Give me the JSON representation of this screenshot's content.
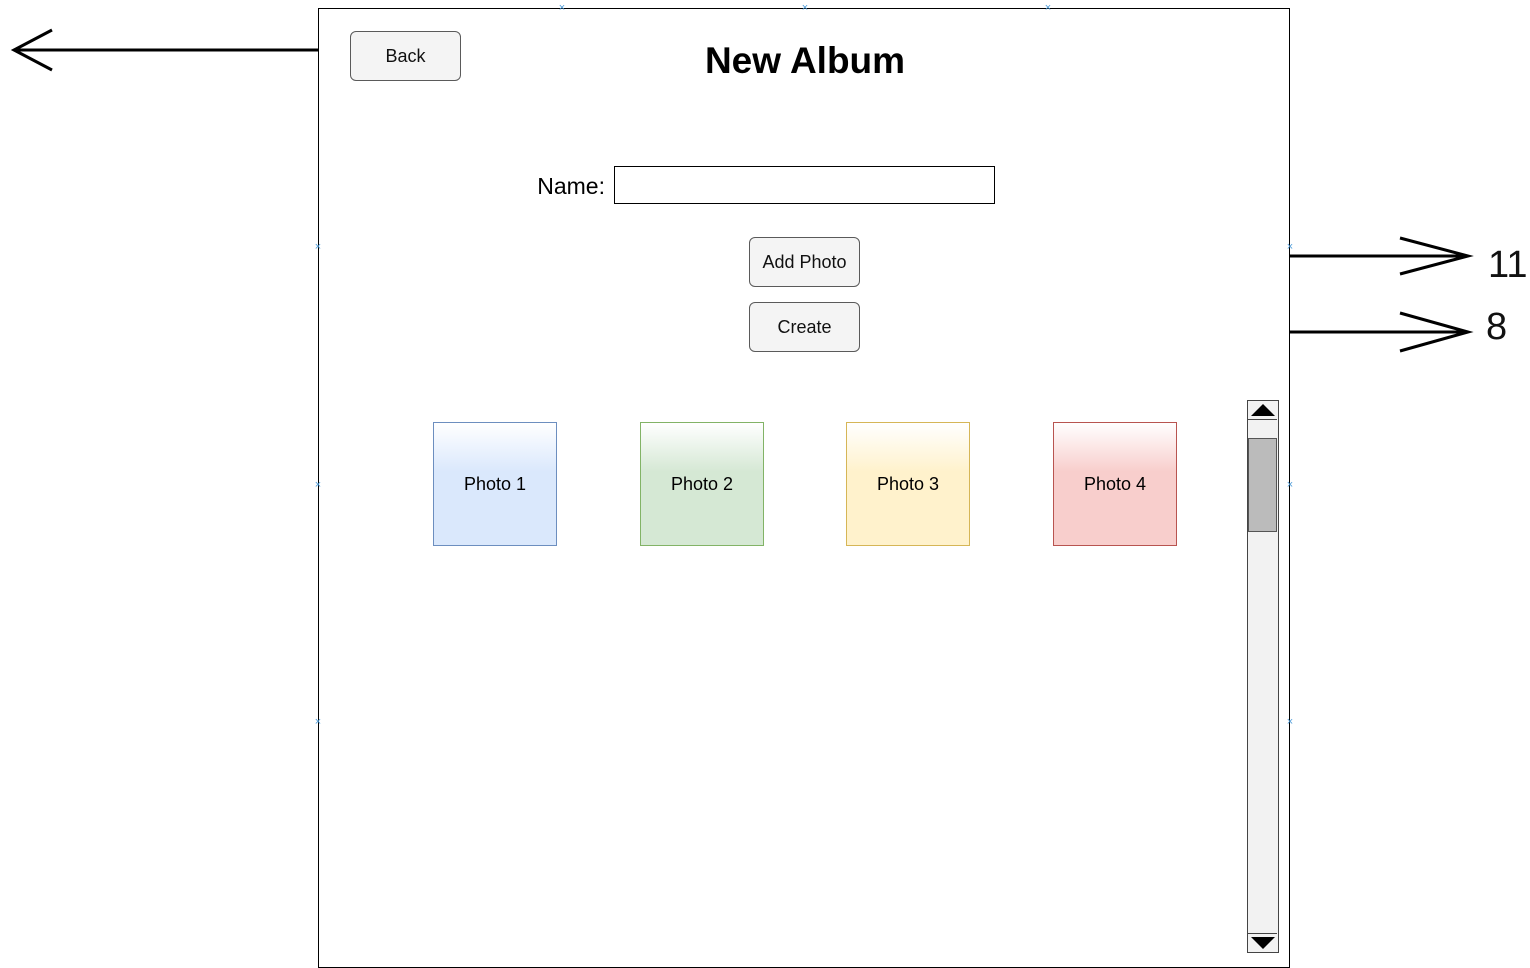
{
  "screen": {
    "title": "New Album",
    "back_label": "Back",
    "name_label": "Name:",
    "name_value": "",
    "add_photo_label": "Add Photo",
    "create_label": "Create",
    "photos": [
      {
        "label": "Photo 1",
        "color": "#dae8fc",
        "border": "#6c8ebf"
      },
      {
        "label": "Photo 2",
        "color": "#d5e8d4",
        "border": "#82b366"
      },
      {
        "label": "Photo 3",
        "color": "#fff2cc",
        "border": "#d6b656"
      },
      {
        "label": "Photo 4",
        "color": "#f8cecc",
        "border": "#b85450"
      }
    ]
  },
  "annotations": {
    "add_photo_target": "11",
    "create_target": "8"
  },
  "colors": {
    "handle": "#4a9ad8",
    "arrow": "#000000"
  }
}
